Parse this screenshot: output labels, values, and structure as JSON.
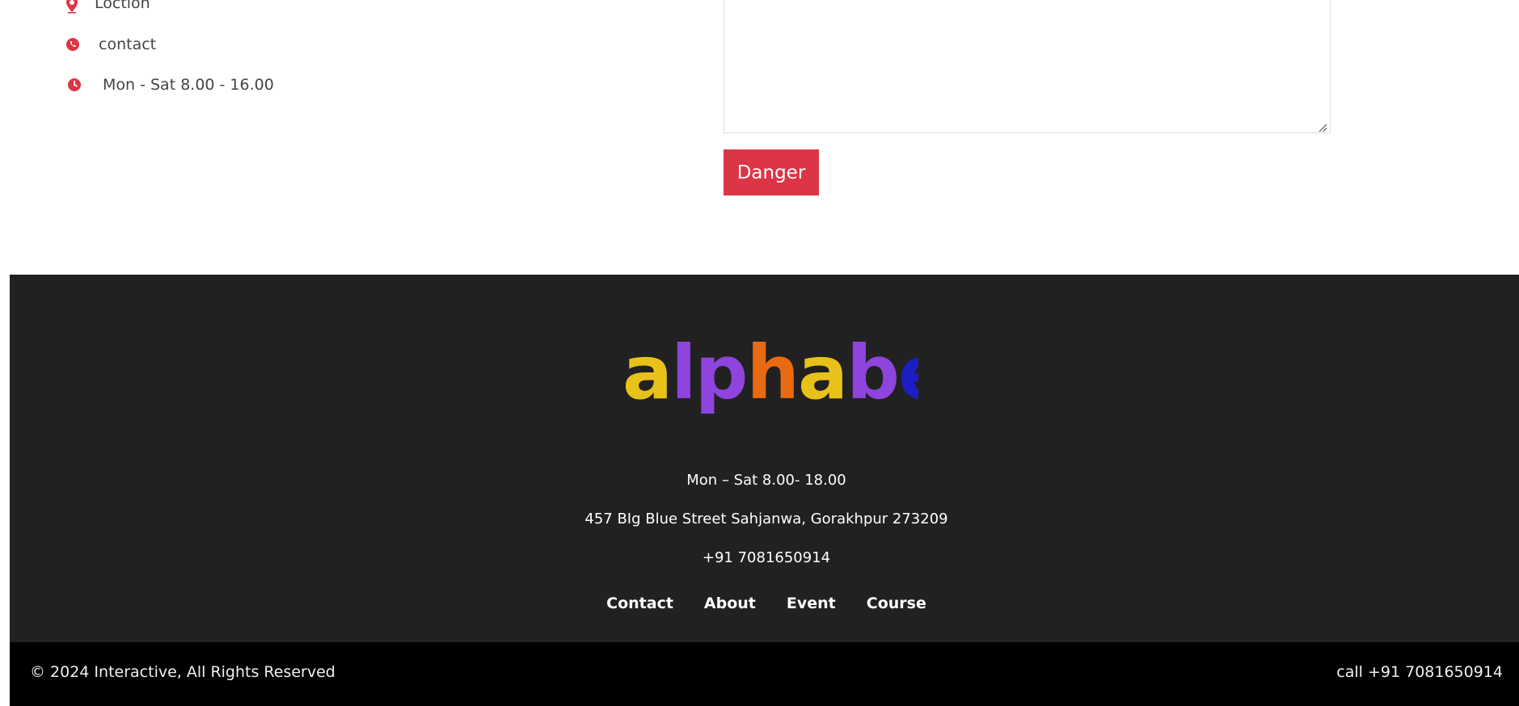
{
  "contact_info": {
    "items": [
      {
        "icon": "map-pin-icon",
        "label": "Loction"
      },
      {
        "icon": "phone-icon",
        "label": "contact"
      },
      {
        "icon": "clock-icon",
        "label": "Mon - Sat 8.00 - 16.00"
      }
    ],
    "icon_color": "#dc3545"
  },
  "form": {
    "message_value": "",
    "submit_label": "Danger",
    "submit_color": "#dc3545"
  },
  "footer": {
    "logo_text": "alphabet",
    "hours": "Mon – Sat 8.00- 18.00",
    "address": "457 BIg Blue Street Sahjanwa, Gorakhpur 273209",
    "phone": "+91 7081650914",
    "nav": [
      "Contact",
      "About",
      "Event",
      "Course"
    ],
    "background": "#212121"
  },
  "bottom_bar": {
    "copyright": "© 2024 Interactive, All Rights Reserved",
    "call": "call +91 7081650914",
    "background": "#000000"
  }
}
